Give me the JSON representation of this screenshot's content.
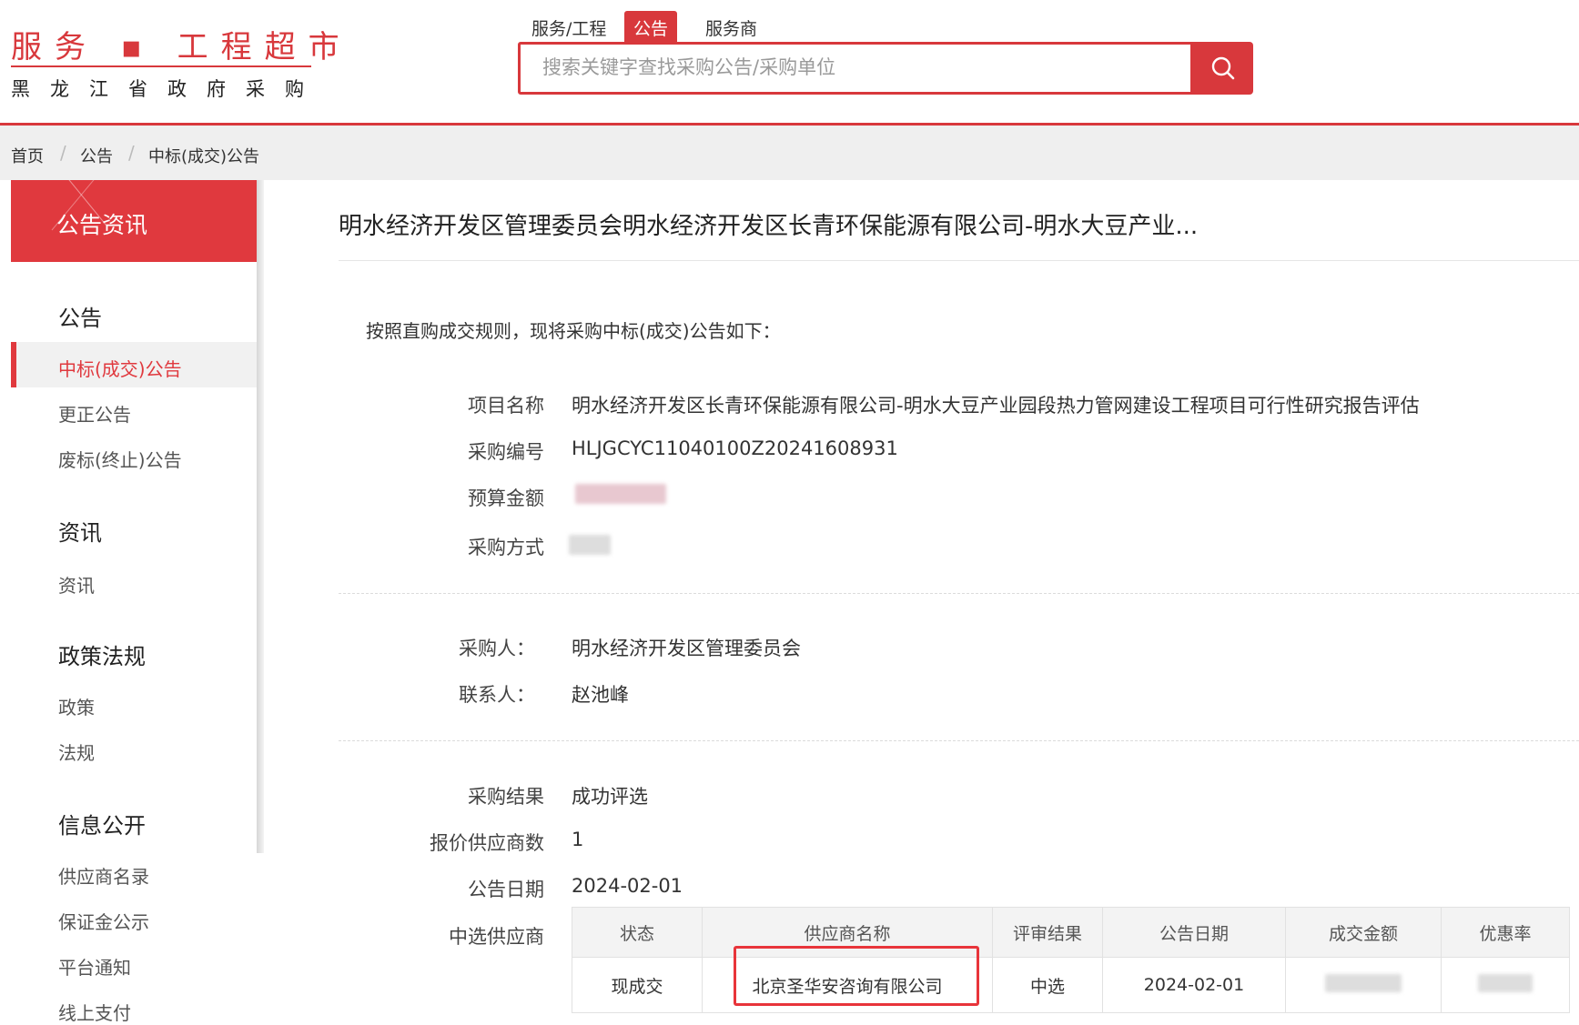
{
  "header": {
    "logo_top": "服务 ▪ 工程超市",
    "logo_bottom": "黑龙江省政府采购",
    "tabs": [
      {
        "label": "服务/工程"
      },
      {
        "label": "公告"
      },
      {
        "label": "服务商"
      }
    ],
    "search_placeholder": "搜索关键字查找采购公告/采购单位"
  },
  "breadcrumb": {
    "items": [
      "首页",
      "公告",
      "中标(成交)公告"
    ],
    "separator": "/"
  },
  "sidebar": {
    "header": "公告资讯",
    "groups": [
      {
        "title": "公告",
        "items": [
          "中标(成交)公告",
          "更正公告",
          "废标(终止)公告"
        ]
      },
      {
        "title": "资讯",
        "items": [
          "资讯"
        ]
      },
      {
        "title": "政策法规",
        "items": [
          "政策",
          "法规"
        ]
      },
      {
        "title": "信息公开",
        "items": [
          "供应商名录",
          "保证金公示",
          "平台通知",
          "线上支付"
        ]
      }
    ]
  },
  "main": {
    "title": "明水经济开发区管理委员会明水经济开发区长青环保能源有限公司-明水大豆产业...",
    "intro": "按照直购成交规则，现将采购中标(成交)公告如下：",
    "fields": {
      "project_name_label": "项目名称",
      "project_name": "明水经济开发区长青环保能源有限公司-明水大豆产业园段热力管网建设工程项目可行性研究报告评估",
      "code_label": "采购编号",
      "code": "HLJGCYC11040100Z20241608931",
      "budget_label": "预算金额",
      "method_label": "采购方式",
      "buyer_label": "采购人：",
      "buyer": "明水经济开发区管理委员会",
      "contact_label": "联系人：",
      "contact": "赵池峰",
      "result_label": "采购结果",
      "result": "成功评选",
      "bidders_label": "报价供应商数",
      "bidders": "1",
      "date_label": "公告日期",
      "date": "2024-02-01",
      "winner_label": "中选供应商"
    },
    "table": {
      "headers": [
        "状态",
        "供应商名称",
        "评审结果",
        "公告日期",
        "成交金额",
        "优惠率"
      ],
      "rows": [
        [
          "现成交",
          "北京圣华安咨询有限公司",
          "中选",
          "2024-02-01",
          "",
          ""
        ]
      ]
    }
  },
  "colors": {
    "brand_red": "#d8383c",
    "highlight_red": "#e8343a"
  }
}
